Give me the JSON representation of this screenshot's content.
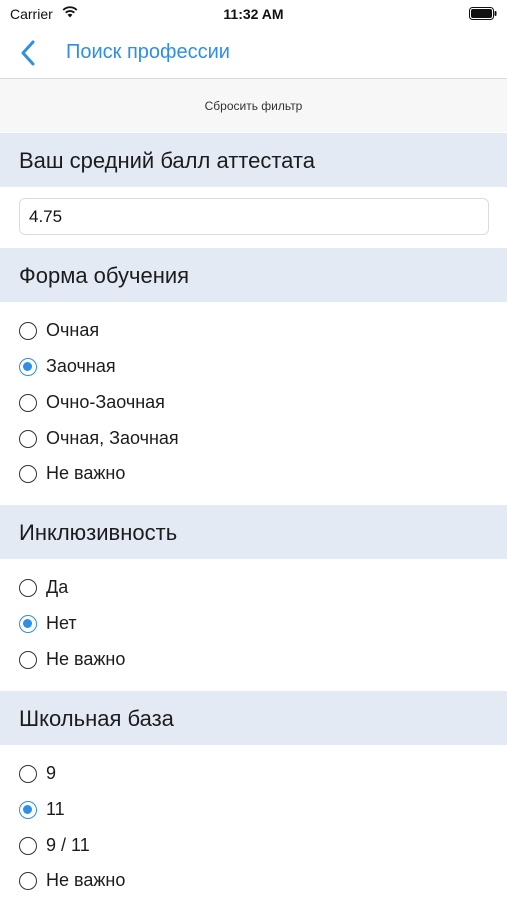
{
  "status_bar": {
    "carrier": "Carrier",
    "time": "11:32 AM"
  },
  "nav": {
    "title": "Поиск профессии"
  },
  "reset_filter": "Сбросить фильтр",
  "gpa": {
    "header": "Ваш средний балл аттестата",
    "value": "4.75"
  },
  "study_form": {
    "header": "Форма обучения",
    "options": [
      "Очная",
      "Заочная",
      "Очно-Заочная",
      "Очная, Заочная",
      "Не важно"
    ],
    "selected": "Заочная"
  },
  "inclusivity": {
    "header": "Инклюзивность",
    "options": [
      "Да",
      "Нет",
      "Не важно"
    ],
    "selected": "Нет"
  },
  "school_base": {
    "header": "Школьная база",
    "options": [
      "9",
      "11",
      "9 / 11",
      "Не важно"
    ],
    "selected": "11"
  },
  "colors": {
    "accent": "#2f8ee6",
    "section_bg": "#e3eaf3"
  }
}
